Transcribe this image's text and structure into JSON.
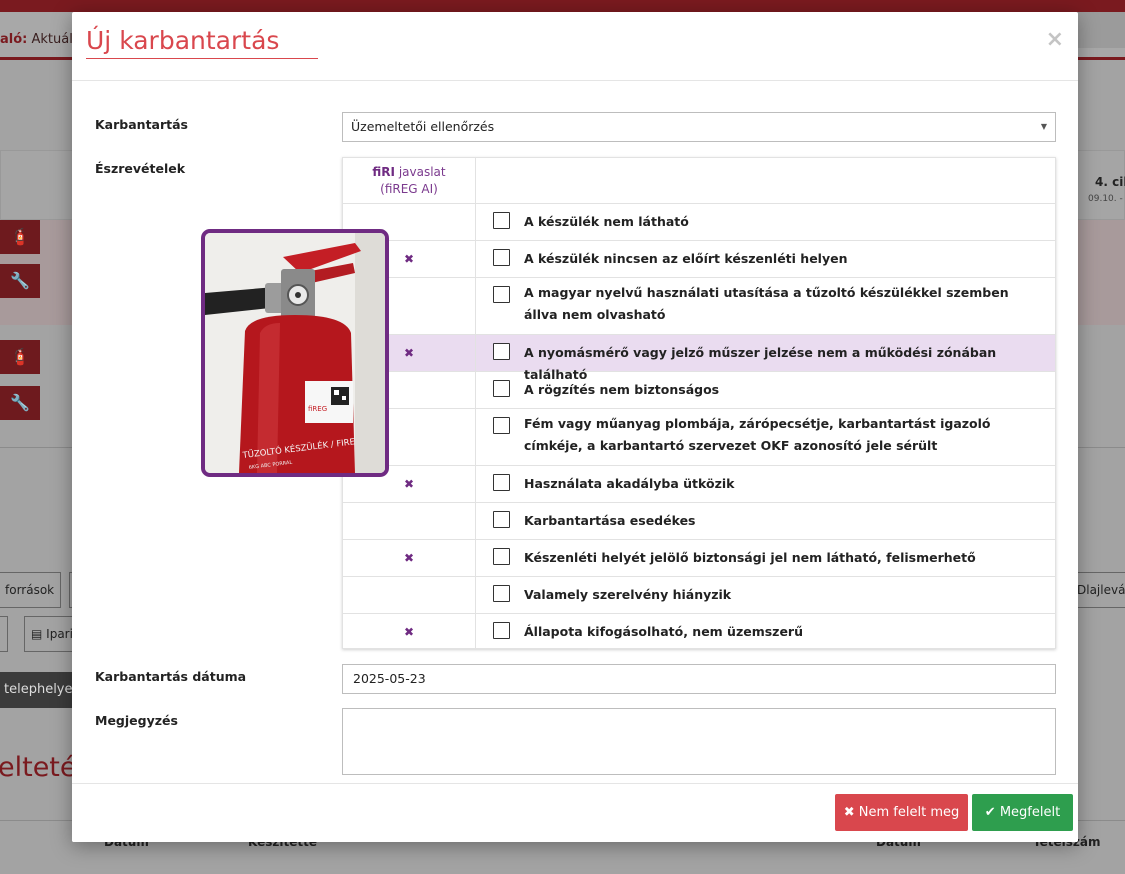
{
  "background": {
    "header_label": "aló:",
    "header_value": "Aktuális",
    "cycle_label": "4. cik",
    "cycle_date": "09.10. -",
    "btn_forrasok": "források",
    "btn_ipari": "Ipari",
    "btn_dlajlevala": "Dlajleválа",
    "dark_button": "telephelyek",
    "section_title": "eltetés",
    "col_datum": "Dátum",
    "col_keszitette": "Készítette",
    "col_datum2": "Dátum",
    "col_tetelszam": "Tételszám"
  },
  "modal": {
    "title": "Új karbantartás",
    "close_glyph": "×",
    "maintenance_label": "Karbantartás",
    "maintenance_value": "Üzemeltetői ellenőrzés",
    "observations_label": "Észrevételek",
    "ai_header_brand": "fiRI",
    "ai_header_rest": " javaslat",
    "ai_header_line2": "(fiREG AI)",
    "ai_mark_glyph": "✖",
    "photo_label_top": "TŰZOLTÓ KÉSZÜLÉK / FIRE",
    "photo_label_bottom": "6KG ABC PORRAL",
    "photo_brand": "fiREG",
    "date_label": "Karbantartás dátuma",
    "date_value": "2025-05-23",
    "notes_label": "Megjegyzés",
    "btn_fail": "Nem felelt meg",
    "btn_ok": "Megfelelt"
  },
  "observations": [
    {
      "text": "A készülék nem látható",
      "ai": false,
      "highlight": false
    },
    {
      "text": "A készülék nincsen az előírt készenléti helyen",
      "ai": true,
      "highlight": false
    },
    {
      "text": "A magyar nyelvű használati utasítása a tűzoltó készülékkel szemben állva nem olvasható",
      "ai": false,
      "highlight": false
    },
    {
      "text": "A nyomásmérő vagy jelző műszer jelzése nem a működési zónában található",
      "ai": true,
      "highlight": true
    },
    {
      "text": "A rögzítés nem biztonságos",
      "ai": false,
      "highlight": false
    },
    {
      "text": "Fém vagy műanyag plombája, zárópecsétje, karbantartást igazoló címkéje, a karbantartó szervezet OKF azonosító jele sérült",
      "ai": false,
      "highlight": false
    },
    {
      "text": "Használata akadályba ütközik",
      "ai": true,
      "highlight": false
    },
    {
      "text": "Karbantartása esedékes",
      "ai": false,
      "highlight": false
    },
    {
      "text": "Készenléti helyét jelölő biztonsági jel nem látható, felismerhető",
      "ai": true,
      "highlight": false
    },
    {
      "text": "Valamely szerelvény hiányzik",
      "ai": false,
      "highlight": false
    },
    {
      "text": "Állapota kifogásolható, nem üzemszerű",
      "ai": true,
      "highlight": false
    }
  ],
  "colors": {
    "accent_red": "#d9474d",
    "ai_purple": "#6f2b82",
    "highlight_row": "#eadcf0",
    "success_green": "#2e9e4e"
  }
}
